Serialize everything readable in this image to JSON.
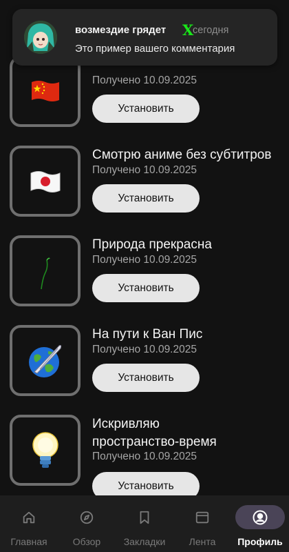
{
  "notification": {
    "username": "возмездие грядет",
    "badge": "X",
    "time": "сегодня",
    "comment": "Это пример вашего комментария"
  },
  "items": [
    {
      "title": "",
      "date": "Получено 10.09.2025",
      "button": "Установить",
      "icon": "china-flag-icon"
    },
    {
      "title": "Смотрю аниме без субтитров",
      "date": "Получено 10.09.2025",
      "button": "Установить",
      "icon": "japan-flag-icon"
    },
    {
      "title": "Природа прекрасна",
      "date": "Получено 10.09.2025",
      "button": "Установить",
      "icon": "sprout-icon"
    },
    {
      "title": "На пути к Ван Пис",
      "date": "Получено 10.09.2025",
      "button": "Установить",
      "icon": "globe-quill-icon"
    },
    {
      "title_line1": "Искривляю",
      "title_line2": "пространство-время",
      "date": "Получено 10.09.2025",
      "button": "Установить",
      "icon": "lightbulb-icon"
    }
  ],
  "nav": [
    {
      "label": "Главная",
      "icon": "home-icon"
    },
    {
      "label": "Обзор",
      "icon": "compass-icon"
    },
    {
      "label": "Закладки",
      "icon": "bookmark-icon"
    },
    {
      "label": "Лента",
      "icon": "feed-icon"
    },
    {
      "label": "Профиль",
      "icon": "profile-icon",
      "active": true
    }
  ],
  "colors": {
    "background": "#121212",
    "button": "#e6e6e6",
    "active_nav": "#4a4457",
    "badge": "#19e619"
  }
}
